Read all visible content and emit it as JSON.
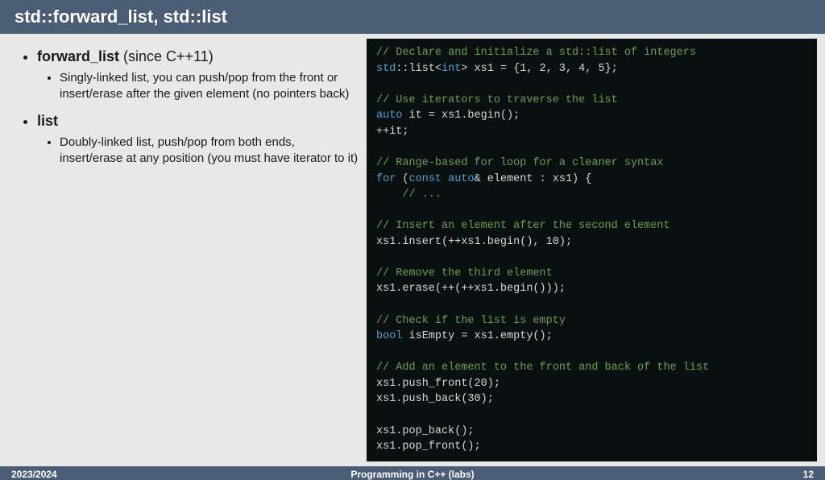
{
  "title": "std::forward_list, std::list",
  "bullets": {
    "b1_strong": "forward_list",
    "b1_rest": " (since C++11)",
    "b1_sub": "Singly-linked list, you can push/pop from the front or insert/erase after the given element (no pointers back)",
    "b2_strong": "list",
    "b2_sub": "Doubly-linked list, push/pop from both ends, insert/erase at any position (you must have iterator to it)"
  },
  "code": {
    "c1": "// Declare and initialize a std::list of integers",
    "l2_a": "std",
    "l2_b": "::list<",
    "l2_c": "int",
    "l2_d": "> xs1 = {1, 2, 3, 4, 5};",
    "c3": "// Use iterators to traverse the list",
    "l4_a": "auto",
    "l4_b": " it = xs1.begin();",
    "l5": "++it;",
    "c6": "// Range-based for loop for a cleaner syntax",
    "l7_a": "for",
    "l7_b": " (",
    "l7_c": "const auto",
    "l7_d": "& element : xs1) {",
    "l8_a": "    ",
    "l8_b": "// ...",
    "c9": "// Insert an element after the second element",
    "l10": "xs1.insert(++xs1.begin(), 10);",
    "c11": "// Remove the third element",
    "l12": "xs1.erase(++(++xs1.begin()));",
    "c13": "// Check if the list is empty",
    "l14_a": "bool",
    "l14_b": " isEmpty = xs1.empty();",
    "c15": "// Add an element to the front and back of the list",
    "l16": "xs1.push_front(20);",
    "l17": "xs1.push_back(30);",
    "l18": "xs1.pop_back();",
    "l19": "xs1.pop_front();"
  },
  "footer": {
    "left": "2023/2024",
    "center": "Programming in C++ (labs)",
    "right": "12"
  }
}
